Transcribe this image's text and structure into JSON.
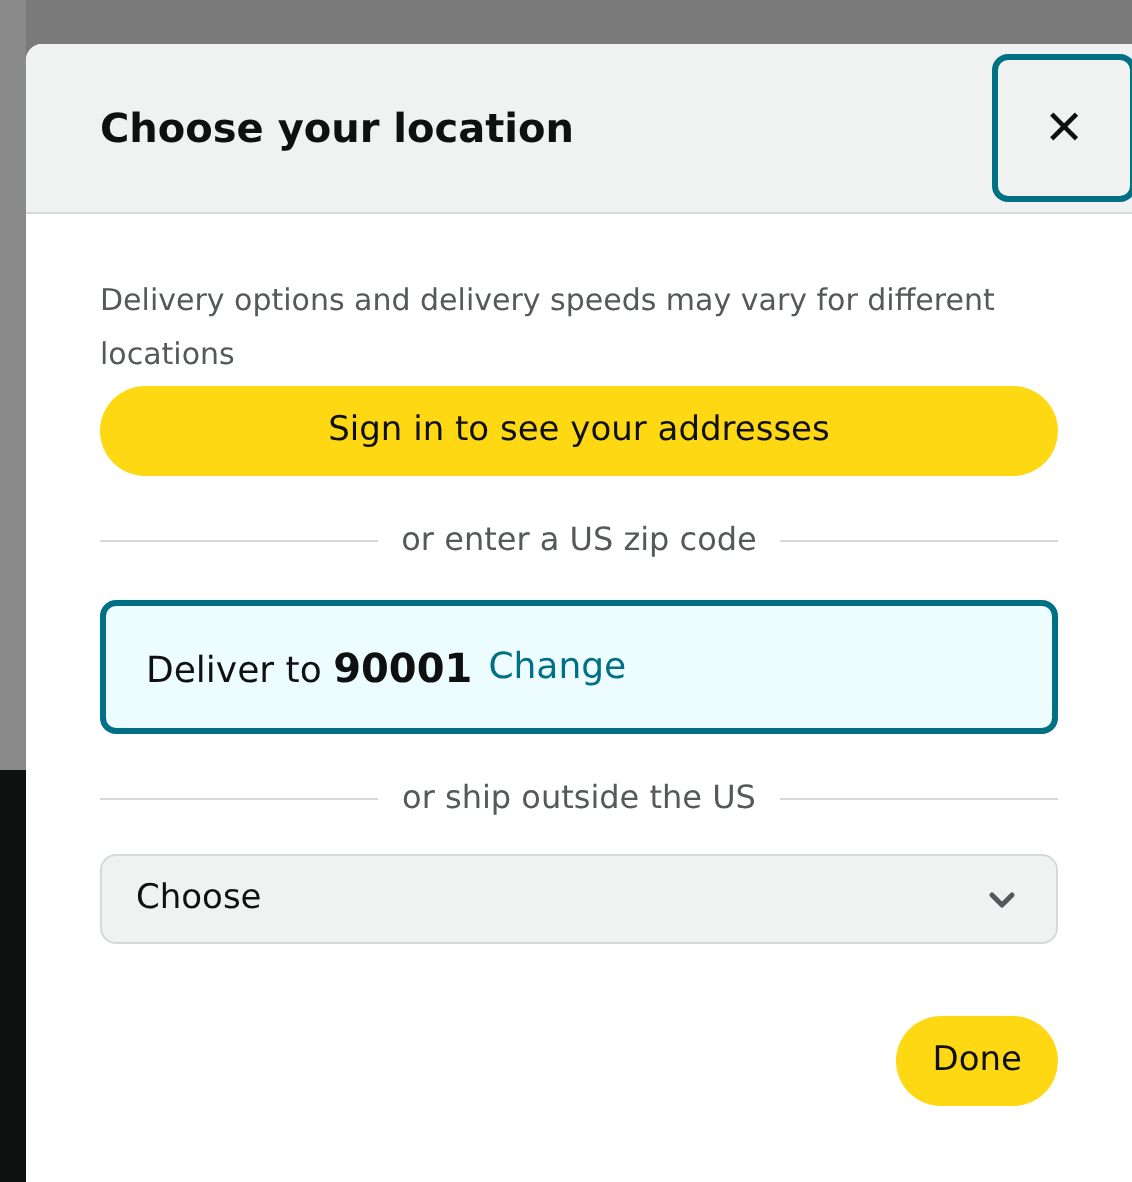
{
  "dialog": {
    "title": "Choose your location",
    "close": "✕"
  },
  "description": "Delivery options and delivery speeds may vary for different locations",
  "sign_in_button": "Sign in to see your addresses",
  "zip_divider": "or enter a US zip code",
  "deliver_to": {
    "label": "Deliver to",
    "zip": "90001",
    "link": "Change"
  },
  "ship_divider": "or ship outside the US",
  "country_select": {
    "value": "Choose"
  },
  "done_button": "Done"
}
